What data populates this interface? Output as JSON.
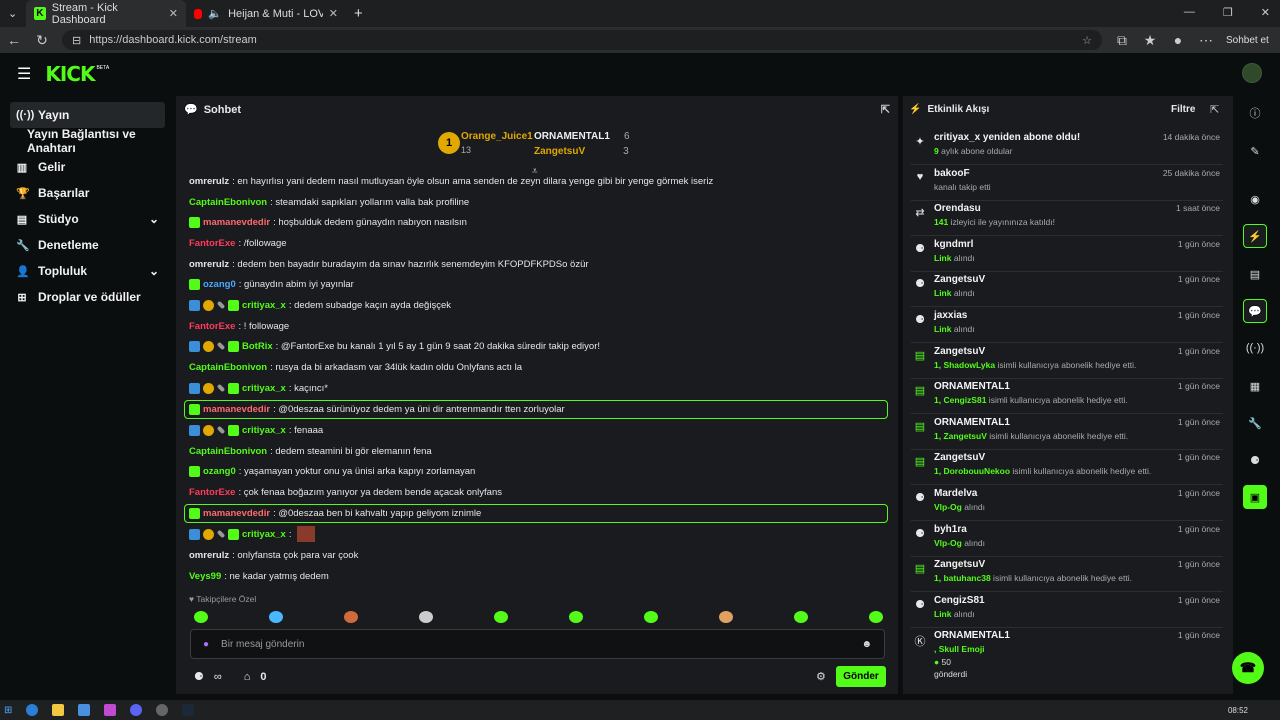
{
  "browser": {
    "tabs": [
      {
        "title": "Stream - Kick Dashboard",
        "close": "✕"
      },
      {
        "title": "Heijan & Muti - LOVE,GUN (O",
        "close": "✕"
      }
    ],
    "new_tab": "+",
    "url": "https://dashboard.kick.com/stream",
    "profile_label": "Sohbet et"
  },
  "header": {
    "logo": "KICK",
    "beta": "BETA"
  },
  "sidebar": {
    "items": [
      {
        "label": "Yayın",
        "icon": "broadcast-icon"
      },
      {
        "label": "Yayın Bağlantısı ve Anahtarı"
      },
      {
        "label": "Gelir",
        "icon": "chart-icon"
      },
      {
        "label": "Başarılar",
        "icon": "trophy-icon"
      },
      {
        "label": "Stüdyo",
        "icon": "studio-icon"
      },
      {
        "label": "Denetleme",
        "icon": "wrench-icon"
      },
      {
        "label": "Topluluk",
        "icon": "community-icon"
      },
      {
        "label": "Droplar ve ödüller",
        "icon": "drops-icon"
      }
    ]
  },
  "chat": {
    "title": "Sohbet",
    "leaderboard": {
      "first": {
        "rank": "1",
        "name": "Orange_Juice1",
        "count": "13"
      },
      "second": {
        "name": "ORNAMENTAL1",
        "count": "6"
      },
      "third": {
        "name": "ZangetsuV",
        "count": "3"
      }
    },
    "messages": [
      {
        "user": "omrerulz",
        "text": ": en hayırlısı yani dedem nasıl mutluysan öyle olsun ama senden de zeyn dilara yenge gibi bir yenge görmek iseriz",
        "color": "#e5e5e5"
      },
      {
        "user": "CaptainEbonivon",
        "text": ": steamdaki sapıkları yollarım valla bak profiline",
        "color": "#53fc18"
      },
      {
        "user": "mamanevdedir",
        "text": ": hoşbulduk dedem günaydın nabıyon nasılsın",
        "color": "#ff6b6b"
      },
      {
        "user": "FantorExe",
        "text": ": /followage",
        "color": "#ff3b5c"
      },
      {
        "user": "omrerulz",
        "text": ": dedem ben bayadır buradayım da sınav hazırlık senemdeyim KFOPDFKPDSo özür",
        "color": "#e5e5e5"
      },
      {
        "user": "ozang0",
        "text": ": günaydın abim iyi yayınlar",
        "color": "#4aa8ff"
      },
      {
        "user": "critiyax_x",
        "text": ": dedem subadge kaçın ayda değişçek",
        "color": "#53fc18"
      },
      {
        "user": "FantorExe",
        "text": ": ! followage",
        "color": "#ff3b5c"
      },
      {
        "user": "BotRix",
        "text": ": @FantorExe bu kanalı 1 yıl 5 ay 1 gün 9 saat 20 dakika süredir takip ediyor!",
        "color": "#53fc18"
      },
      {
        "user": "CaptainEbonivon",
        "text": ": rusya da bi arkadasm var 34lük kadın oldu Onlyfans actı la",
        "color": "#53fc18"
      },
      {
        "user": "critiyax_x",
        "text": ": kaçıncı*",
        "color": "#53fc18"
      },
      {
        "user": "mamanevdedir",
        "text": ": @0deszaa sürünüyoz dedem ya üni dir antrenmandır tten zorluyolar",
        "color": "#ff6b6b"
      },
      {
        "user": "critiyax_x",
        "text": ": fenaaa",
        "color": "#53fc18"
      },
      {
        "user": "CaptainEbonivon",
        "text": ": dedem steamini bi gör elemanın fena",
        "color": "#53fc18"
      },
      {
        "user": "ozang0",
        "text": ": yaşamayan yoktur onu ya ünisi arka kapıyı zorlamayan",
        "color": "#53fc18"
      },
      {
        "user": "FantorExe",
        "text": ": çok fenaa boğazım yanıyor ya dedem bende açacak onlyfans",
        "color": "#ff3b5c"
      },
      {
        "user": "mamanevdedir",
        "text": ": @0deszaa ben bi kahvaltı yapıp geliyom iznimle",
        "color": "#ff6b6b"
      },
      {
        "user": "critiyax_x",
        "text": ":",
        "color": "#53fc18"
      },
      {
        "user": "omrerulz",
        "text": ": onlyfansta çok para var çook",
        "color": "#e5e5e5"
      },
      {
        "user": "Veys99",
        "text": ": ne kadar yatmış dedem",
        "color": "#53fc18"
      }
    ],
    "emote_label": "Takipçilere Özel",
    "input_placeholder": "Bir mesaj gönderin",
    "viewers": "∞",
    "points": "0",
    "send_label": "Gönder"
  },
  "activity": {
    "title": "Etkinlik Akışı",
    "filter": "Filtre",
    "items": [
      {
        "name": "critiyax_x yeniden abone oldu!",
        "hl": "9",
        "sub": " aylık abone oldular",
        "time": "14 dakika önce",
        "icon": "sparkle-icon"
      },
      {
        "name": "bakooF",
        "hl": "",
        "sub": "kanalı takip etti",
        "time": "25 dakika önce",
        "icon": "heart-icon"
      },
      {
        "name": "Orendasu",
        "hl": "141",
        "sub": " izleyici ile yayınınıza katıldı!",
        "time": "1 saat önce",
        "icon": "raid-icon"
      },
      {
        "name": "kgndmrl",
        "hl": "Link",
        "sub": " alındı",
        "time": "1 gün önce",
        "icon": "drop-icon"
      },
      {
        "name": "ZangetsuV",
        "hl": "Link",
        "sub": " alındı",
        "time": "1 gün önce",
        "icon": "drop-icon"
      },
      {
        "name": "jaxxias",
        "hl": "Link",
        "sub": " alındı",
        "time": "1 gün önce",
        "icon": "drop-icon"
      },
      {
        "name": "ZangetsuV",
        "hl": "1, ShadowLyka",
        "sub": " isimli kullanıcıya abonelik hediye etti.",
        "time": "1 gün önce",
        "icon": "gift-icon"
      },
      {
        "name": "ORNAMENTAL1",
        "hl": "1, CengizS81",
        "sub": " isimli kullanıcıya abonelik hediye etti.",
        "time": "1 gün önce",
        "icon": "gift-icon"
      },
      {
        "name": "ORNAMENTAL1",
        "hl": "1, ZangetsuV",
        "sub": " isimli kullanıcıya abonelik hediye etti.",
        "time": "1 gün önce",
        "icon": "gift-icon"
      },
      {
        "name": "ZangetsuV",
        "hl": "1, DorobouuNekoo",
        "sub": " isimli kullanıcıya abonelik hediye etti.",
        "time": "1 gün önce",
        "icon": "gift-icon"
      },
      {
        "name": "Mardelva",
        "hl": "Vlp-Og",
        "sub": " alındı",
        "time": "1 gün önce",
        "icon": "drop-icon"
      },
      {
        "name": "byh1ra",
        "hl": "Vlp-Og",
        "sub": " alındı",
        "time": "1 gün önce",
        "icon": "drop-icon"
      },
      {
        "name": "ZangetsuV",
        "hl": "1, batuhanc38",
        "sub": " isimli kullanıcıya abonelik hediye etti.",
        "time": "1 gün önce",
        "icon": "gift-icon"
      },
      {
        "name": "CengizS81",
        "hl": "Link",
        "sub": " alındı",
        "time": "1 gün önce",
        "icon": "drop-icon"
      },
      {
        "name": "ORNAMENTAL1",
        "hl": ", Skull Emoji",
        "sub": "",
        "time": "1 gün önce",
        "icon": "kick-icon",
        "extra_count": "50",
        "extra_text": "gönderdi"
      }
    ]
  },
  "taskbar": {
    "time": "08:52"
  }
}
